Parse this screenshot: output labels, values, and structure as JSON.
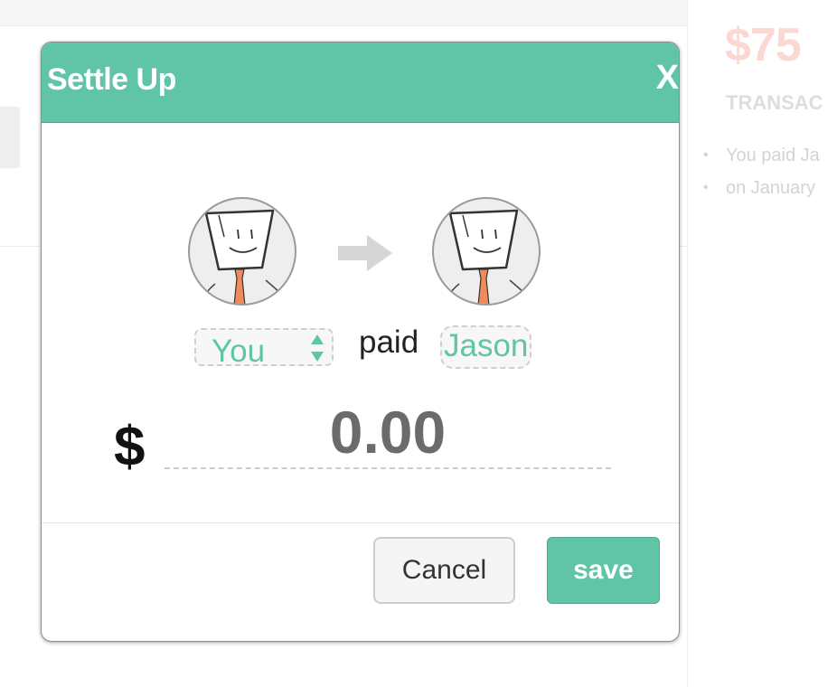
{
  "background": {
    "amount": "$75",
    "heading": "TRANSAC",
    "transactions": [
      "You paid Ja",
      "on January"
    ]
  },
  "modal": {
    "title": "Settle Up",
    "close_label": "X",
    "payer": "You",
    "verb": "paid",
    "recipient": "Jason",
    "currency_symbol": "$",
    "amount_placeholder": "0.00",
    "cancel_label": "Cancel",
    "save_label": "save"
  },
  "colors": {
    "accent": "#5fc5a6",
    "amount_faded": "#fbd8d2"
  },
  "icons": {
    "payer_avatar": "avatar-icon",
    "recipient_avatar": "avatar-icon",
    "direction": "arrow-right-icon",
    "select": "select-arrows-icon"
  }
}
